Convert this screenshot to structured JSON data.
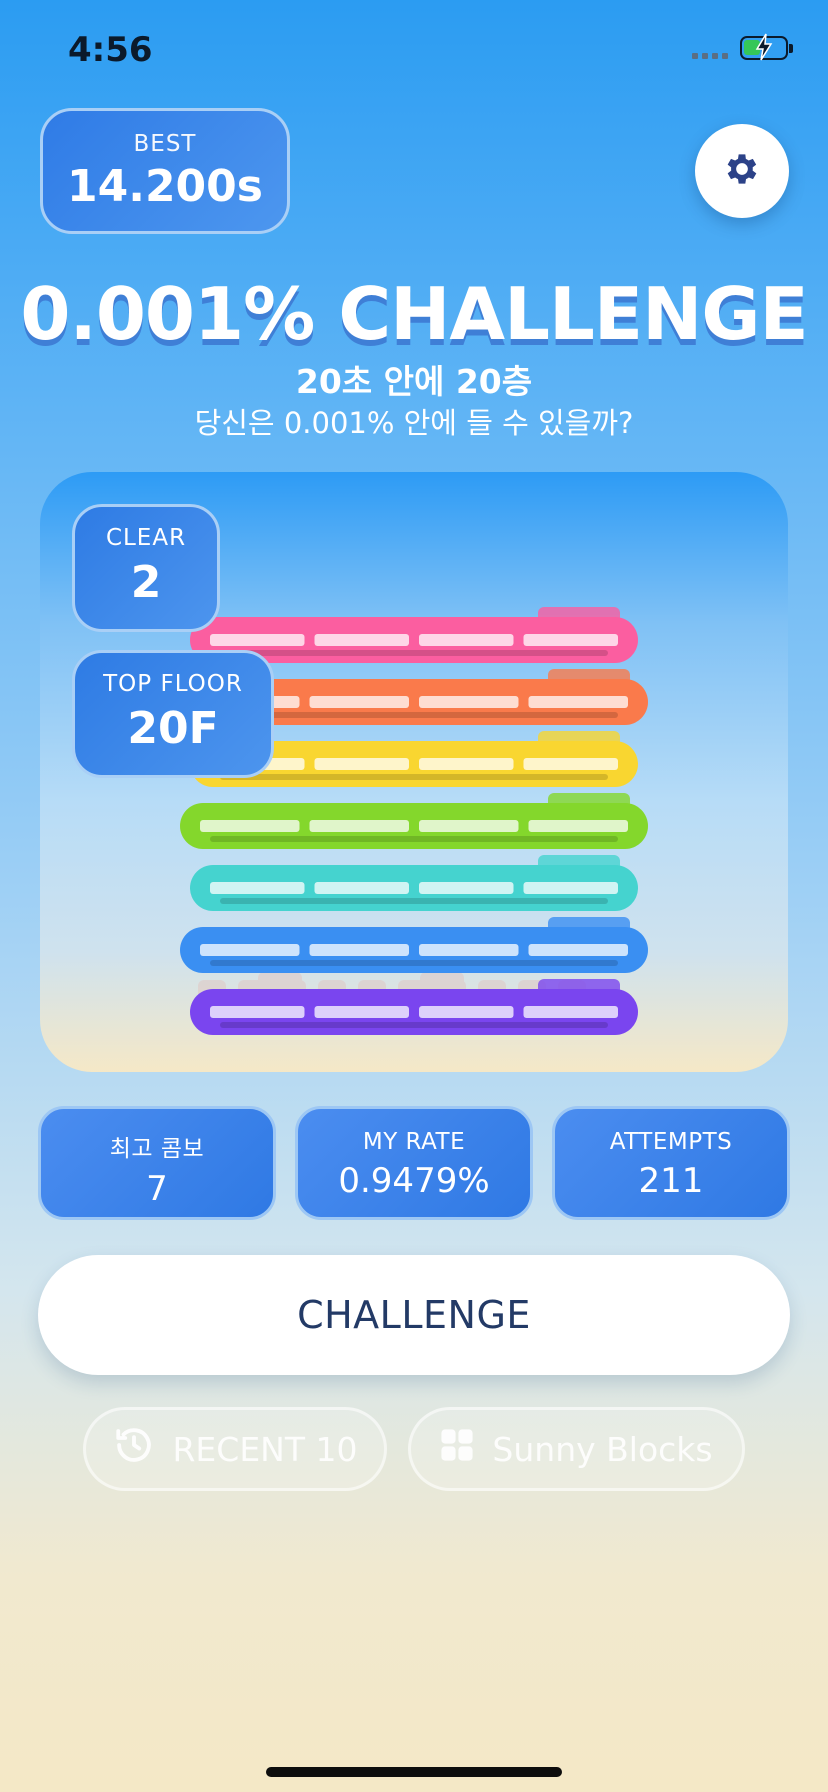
{
  "status_bar": {
    "time": "4:56"
  },
  "best": {
    "label": "BEST",
    "value": "14.200s"
  },
  "header": {
    "title": "0.001% CHALLENGE",
    "subtitle": "20초 안에 20층",
    "tagline": "당신은 0.001% 안에 들 수 있을까?"
  },
  "tower": {
    "clear_label": "CLEAR",
    "clear_value": "2",
    "top_floor_label": "TOP FLOOR",
    "top_floor_value": "20F",
    "block_colors": [
      "#fb5ea0",
      "#fa7a4b",
      "#f9d630",
      "#84d72c",
      "#45d3cf",
      "#3a8ff2",
      "#7a45ef"
    ]
  },
  "stats": [
    {
      "label": "최고 콤보",
      "value": "7"
    },
    {
      "label": "MY RATE",
      "value": "0.9479%"
    },
    {
      "label": "ATTEMPTS",
      "value": "211"
    }
  ],
  "actions": {
    "challenge_label": "CHALLENGE",
    "recent_label": "RECENT 10",
    "sunny_label": "Sunny Blocks"
  },
  "icons": {
    "settings": "gear-icon",
    "recent": "history-icon",
    "blocks": "grid-icon"
  }
}
